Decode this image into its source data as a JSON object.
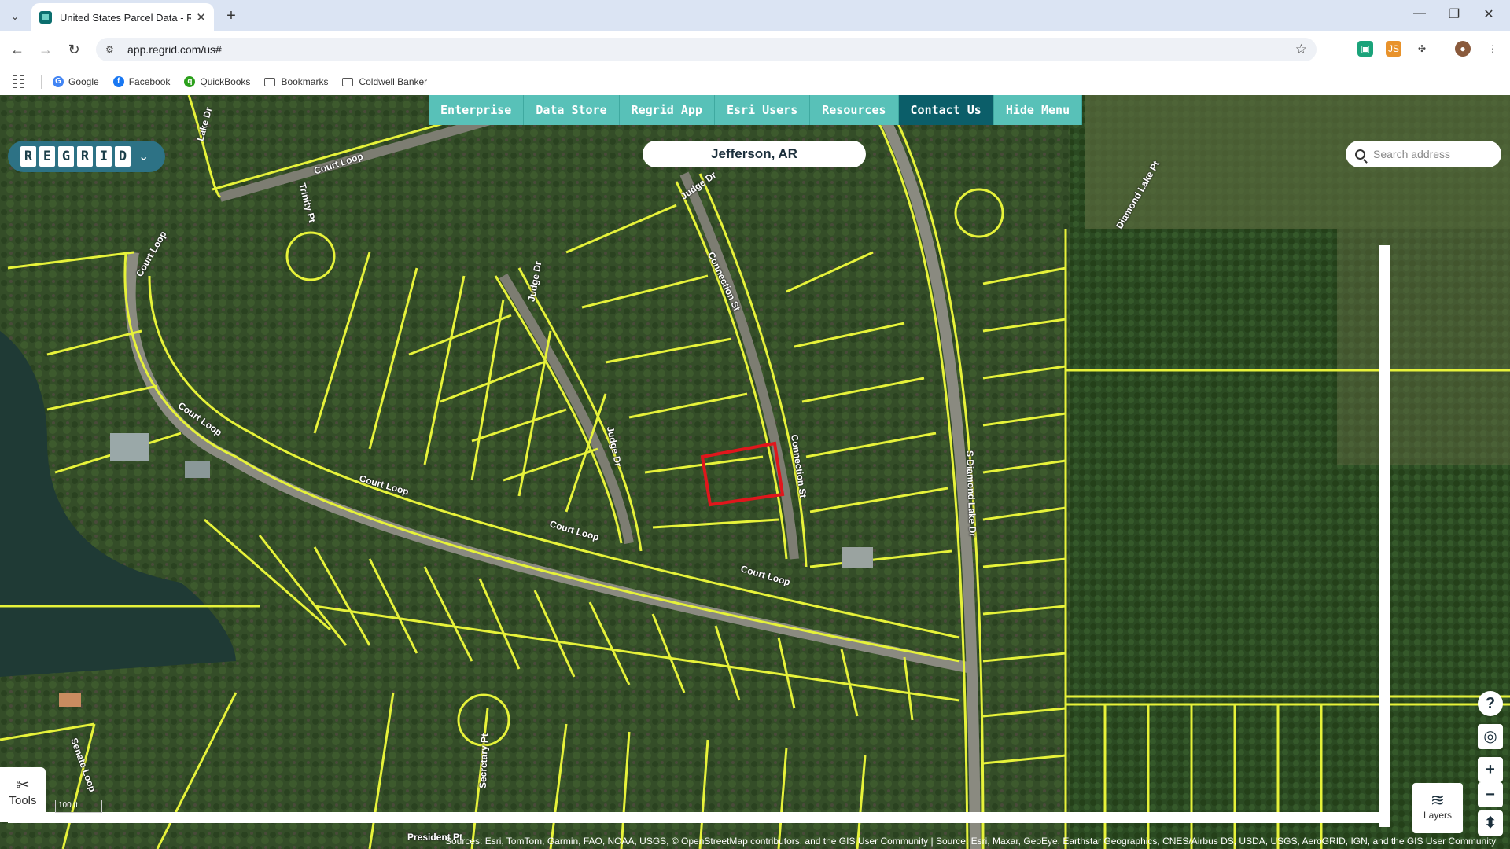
{
  "browser": {
    "tab_title": "United States Parcel Data - Reg",
    "url": "app.regrid.com/us#",
    "bookmarks": [
      "Google",
      "Facebook",
      "QuickBooks",
      "Bookmarks",
      "Coldwell Banker"
    ]
  },
  "topnav": {
    "items": [
      "Enterprise",
      "Data Store",
      "Regrid App",
      "Esri Users",
      "Resources",
      "Contact Us",
      "Hide Menu"
    ],
    "active": "Contact Us"
  },
  "brand": {
    "letters": [
      "R",
      "E",
      "G",
      "R",
      "I",
      "D"
    ]
  },
  "region": "Jefferson, AR",
  "search": {
    "placeholder": "Search address"
  },
  "tools_label": "Tools",
  "layers_label": "Layers",
  "scale": "100 ft",
  "attribution": "Sources: Esri, TomTom, Garmin, FAO, NOAA, USGS, © OpenStreetMap contributors, and the GIS User Community | Source: Esri, Maxar, GeoEye, Earthstar Geographics, CNES/Airbus DS, USDA, USGS, AeroGRID, IGN, and the GIS User Community",
  "streets": [
    "Court Loop",
    "Court Loop",
    "Court Loop",
    "Court Loop",
    "Court Loop",
    "Court Loop",
    "Judge Dr",
    "Judge Dr",
    "Judge Dr",
    "Connection St",
    "Connection St",
    "Trinity Pt",
    "S Diamond Lake Dr",
    "Diamond Lake Pt",
    "Secretary Pt",
    "Senate Loop",
    "President Pt",
    "Lake Dr"
  ],
  "colors": {
    "parcel_line": "#e6f23a",
    "selected_parcel": "#e0161c",
    "nav_bg": "#58c1b8",
    "nav_active": "#0b5e69",
    "brand_bg": "#2d7285"
  }
}
